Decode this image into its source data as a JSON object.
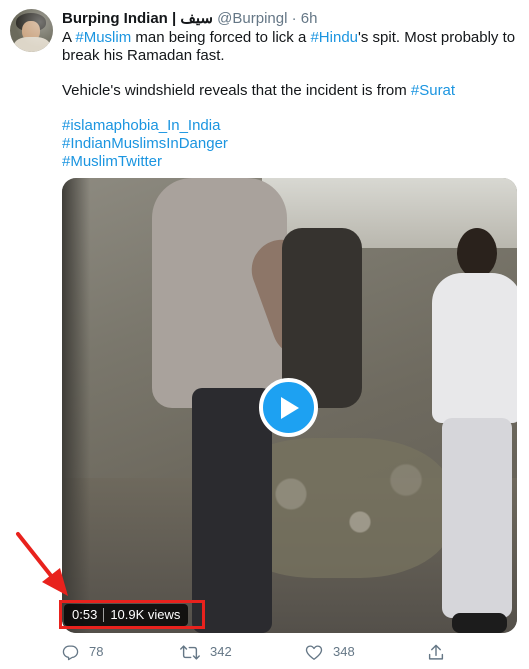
{
  "tweet": {
    "author_name": "Burping Indian | سيف",
    "handle": "@Burpingl",
    "dot": "·",
    "time": "6h",
    "line1": {
      "t1": "A ",
      "tag1": "#Muslim",
      "t2": " man being forced to lick a ",
      "tag2": "#Hindu",
      "t3": "'s spit. Most probably to"
    },
    "line2": "break his Ramadan fast.",
    "line3": {
      "t1": "Vehicle's windshield reveals that the incident is from ",
      "tag1": "#Surat"
    },
    "hashtags": [
      "#islamaphobia_In_India",
      "#IndianMuslimsInDanger",
      "#MuslimTwitter"
    ]
  },
  "video": {
    "duration": "0:53",
    "views": "10.9K views"
  },
  "actions": {
    "replies": "78",
    "retweets": "342",
    "likes": "348"
  },
  "colors": {
    "link": "#1b95e0",
    "play_button": "#1da1f2",
    "annotation": "#e8221d",
    "muted_text": "#657786"
  },
  "icons": [
    "reply-icon",
    "retweet-icon",
    "like-icon",
    "share-icon",
    "play-icon",
    "annotation-arrow"
  ]
}
